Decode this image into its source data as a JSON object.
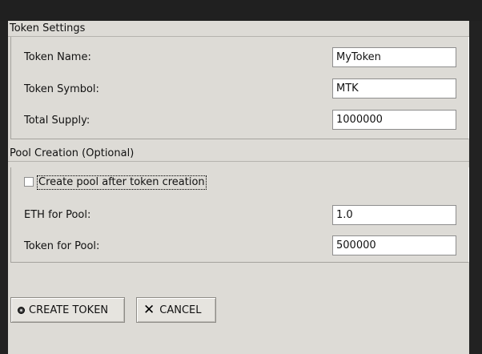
{
  "token_settings": {
    "header": "Token Settings",
    "fields": [
      {
        "label": "Token Name:",
        "value": "MyToken"
      },
      {
        "label": "Token Symbol:",
        "value": "MTK"
      },
      {
        "label": "Total Supply:",
        "value": "1000000"
      }
    ]
  },
  "pool_creation": {
    "header": "Pool Creation (Optional)",
    "checkbox_label": "Create pool after token creation",
    "checkbox_checked": false,
    "fields": [
      {
        "label": "ETH for Pool:",
        "value": "1.0"
      },
      {
        "label": "Token for Pool:",
        "value": "500000"
      }
    ]
  },
  "buttons": {
    "create_label": "CREATE TOKEN",
    "create_icon": "coin-icon",
    "cancel_label": "CANCEL",
    "cancel_icon": "x-icon"
  }
}
